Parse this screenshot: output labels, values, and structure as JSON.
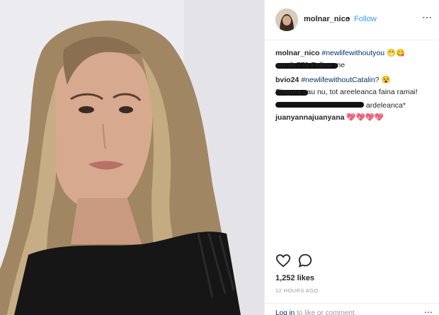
{
  "post": {
    "author": "molnar_nico",
    "separator": "•",
    "follow_label": "Follow",
    "more_icon": "more-options-icon",
    "image_icon": "post-photo"
  },
  "comments": [
    {
      "user": "molnar_nico",
      "text": "",
      "tags": "#newlifewithoutyou",
      "emoji": "😁😋"
    },
    {
      "user": "",
      "text": "samilc779 Follow me",
      "tags": "",
      "emoji": ""
    },
    {
      "user": "bvio24",
      "text": "",
      "tags": "#newlifewithoutCatalin?",
      "emoji": "😵"
    },
    {
      "user": "",
      "text": "Singura sau nu, tot areeleanca faina ramai!",
      "tags": "",
      "emoji": ""
    },
    {
      "user": "",
      "text": "ardeleanca*",
      "tags": "",
      "emoji": ""
    },
    {
      "user": "juanyannajuanyana",
      "text": "",
      "tags": "",
      "emoji": "💖💖💖💖"
    }
  ],
  "actions": {
    "like_icon": "heart-icon",
    "comment_icon": "comment-bubble-icon"
  },
  "likes": "1,252 likes",
  "timestamp": "12 HOURS AGO",
  "login": {
    "link": "Log in",
    "rest": "to like or comment."
  },
  "colors": {
    "link_blue": "#3897f0",
    "hashtag": "#003569",
    "muted": "#999999"
  }
}
